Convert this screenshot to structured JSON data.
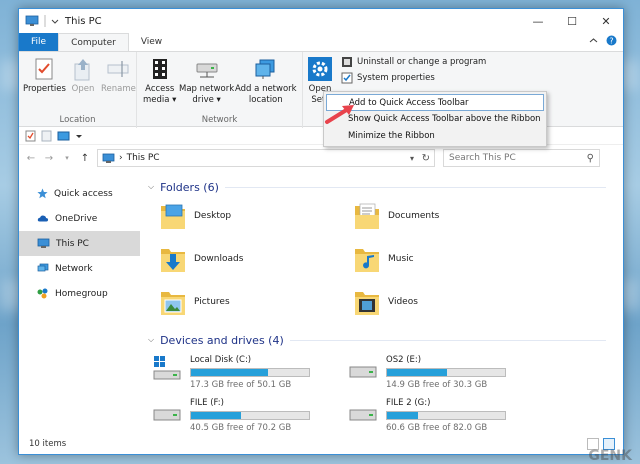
{
  "window": {
    "title": "This PC",
    "controls": {
      "minimize": "—",
      "maximize": "☐",
      "close": "✕"
    }
  },
  "tabs": [
    {
      "label": "File"
    },
    {
      "label": "Computer"
    },
    {
      "label": "View"
    }
  ],
  "ribbon": {
    "location_group": {
      "label": "Location",
      "buttons": [
        {
          "label": "Properties"
        },
        {
          "label": "Open"
        },
        {
          "label": "Rename"
        }
      ]
    },
    "network_group": {
      "label": "Network",
      "buttons": [
        {
          "label_line1": "Access",
          "label_line2": "media ▾"
        },
        {
          "label_line1": "Map network",
          "label_line2": "drive ▾"
        },
        {
          "label_line1": "Add a network",
          "label_line2": "location"
        }
      ]
    },
    "system_group": {
      "open_settings_line1": "Open",
      "open_settings_line2": "Sett",
      "uninstall": "Uninstall or change a program",
      "system_properties": "System properties"
    }
  },
  "context_menu": {
    "items": [
      {
        "label": "Add to Quick Access Toolbar"
      },
      {
        "label": "Show Quick Access Toolbar above the Ribbon"
      },
      {
        "label": "Minimize the Ribbon"
      }
    ]
  },
  "address_bar": {
    "path": "This PC",
    "separator": "›",
    "search_placeholder": "Search This PC"
  },
  "nav_pane": {
    "items": [
      {
        "label": "Quick access"
      },
      {
        "label": "OneDrive"
      },
      {
        "label": "This PC"
      },
      {
        "label": "Network"
      },
      {
        "label": "Homegroup"
      }
    ]
  },
  "folders_section": {
    "title": "Folders (6)",
    "items": [
      {
        "label": "Desktop"
      },
      {
        "label": "Documents"
      },
      {
        "label": "Downloads"
      },
      {
        "label": "Music"
      },
      {
        "label": "Pictures"
      },
      {
        "label": "Videos"
      }
    ]
  },
  "drives_section": {
    "title": "Devices and drives (4)",
    "items": [
      {
        "label": "Local Disk (C:)",
        "free": "17.3 GB free of 50.1 GB",
        "used_fraction": 0.65
      },
      {
        "label": "OS2 (E:)",
        "free": "14.9 GB free of 30.3 GB",
        "used_fraction": 0.51
      },
      {
        "label": "FILE (F:)",
        "free": "40.5 GB free of 70.2 GB",
        "used_fraction": 0.42
      },
      {
        "label": "FILE 2 (G:)",
        "free": "60.6 GB free of 82.0 GB",
        "used_fraction": 0.26
      }
    ]
  },
  "status_bar": {
    "items_count": "10 items"
  },
  "watermark": "GENK",
  "colors": {
    "accent": "#1979ca",
    "bar_fill": "#26a0da",
    "folder_yellow": "#f8d775",
    "section_title": "#1e3287",
    "arrow": "#e8434c"
  }
}
